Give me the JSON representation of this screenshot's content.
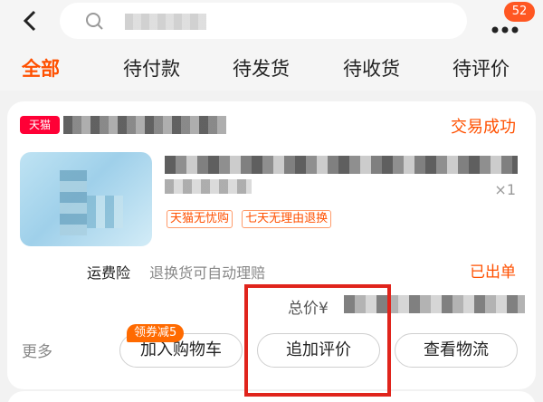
{
  "header": {
    "more_badge": "52"
  },
  "tabs": [
    {
      "label": "全部",
      "active": true
    },
    {
      "label": "待付款",
      "active": false
    },
    {
      "label": "待发货",
      "active": false
    },
    {
      "label": "待收货",
      "active": false
    },
    {
      "label": "待评价",
      "active": false
    }
  ],
  "order": {
    "platform_tag": "天猫",
    "status": "交易成功",
    "quantity": "×1",
    "promo_tags": [
      "天猫无忧购",
      "七天无理由退换"
    ],
    "insurance_label": "运费险",
    "insurance_desc": "退换货可自动理赔",
    "shipping_status": "已出单",
    "total_label": "总价¥",
    "more_label": "更多",
    "coupon_badge": "领券减5",
    "buttons": {
      "add_to_cart": "加入购物车",
      "add_review": "追加评价",
      "view_logistics": "查看物流"
    }
  },
  "colors": {
    "accent": "#ff5000",
    "tmall_red": "#ff0036",
    "highlight": "#e0241c"
  }
}
